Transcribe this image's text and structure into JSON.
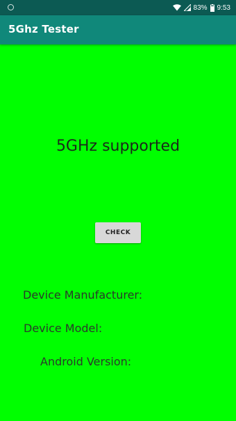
{
  "status_bar": {
    "battery_percent": "83%",
    "time": "9:53",
    "icons": [
      "notification-dot-icon",
      "wifi-icon",
      "cell-signal-icon",
      "battery-icon"
    ]
  },
  "app_bar": {
    "title": "5Ghz Tester",
    "color": "#10887a"
  },
  "main": {
    "background_color": "#00ff00",
    "result_text": "5GHz supported",
    "check_button_label": "CHECK",
    "device_manufacturer_label": "Device Manufacturer:",
    "device_model_label": "Device Model:",
    "android_version_label": "Android Version:"
  }
}
